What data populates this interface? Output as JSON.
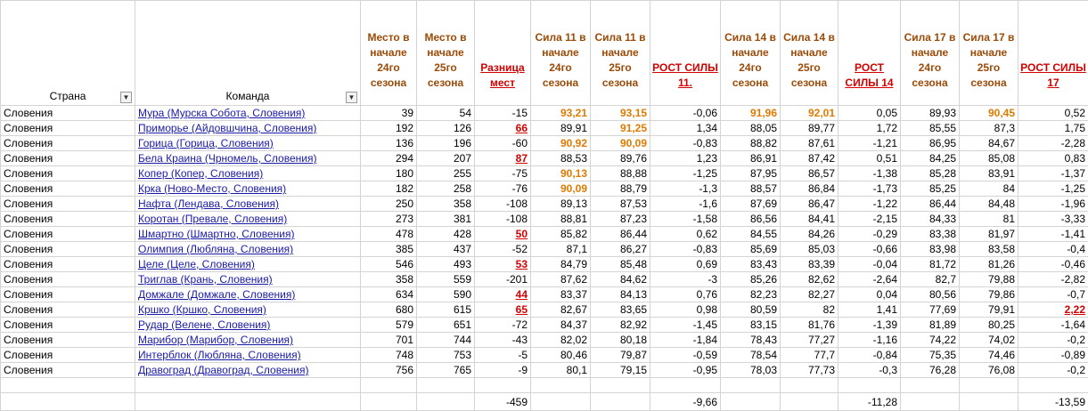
{
  "headers": {
    "country": "Страна",
    "team": "Команда",
    "place24": "Место в начале 24го сезона",
    "place25": "Место в начале 25го сезона",
    "diff": "Разница мест",
    "s11_24": "Сила 11 в начале 24го сезона",
    "s11_25": "Сила 11 в начале 25го сезона",
    "g11": "РОСТ СИЛЫ 11.",
    "s14_24": "Сила 14 в начале 24го сезона",
    "s14_25": "Сила 14 в начале 25го сезона",
    "g14": "РОСТ СИЛЫ 14",
    "s17_24": "Сила 17 в начале 24го сезона",
    "s17_25": "Сила 17 в начале 25го сезона",
    "g17": "РОСТ СИЛЫ 17"
  },
  "icons": {
    "country_filter": "filter-active-icon",
    "team_filter": "dropdown-arrow-icon"
  },
  "colors": {
    "highlight": "#e07a00",
    "red": "#d40000",
    "header": "#9c4a07",
    "link": "#1a1aa8"
  },
  "rows": [
    {
      "country": "Словения",
      "team": "Мура (Мурска Собота, Словения)",
      "p24": "39",
      "p25": "54",
      "diff": "-15",
      "s11a": "93,21",
      "s11b": "93,15",
      "g11": "-0,06",
      "s14a": "91,96",
      "s14b": "92,01",
      "g14": "0,05",
      "s17a": "89,93",
      "s17b": "90,45",
      "g17": "0,52",
      "hl": [
        "s11a",
        "s11b",
        "s14a",
        "s14b",
        "s17b"
      ]
    },
    {
      "country": "Словения",
      "team": "Приморье (Айдовшчина, Словения)",
      "p24": "192",
      "p25": "126",
      "diff": "66",
      "s11a": "89,91",
      "s11b": "91,25",
      "g11": "1,34",
      "s14a": "88,05",
      "s14b": "89,77",
      "g14": "1,72",
      "s17a": "85,55",
      "s17b": "87,3",
      "g17": "1,75",
      "hl": [
        "s11b"
      ],
      "rd": [
        "diff"
      ]
    },
    {
      "country": "Словения",
      "team": "Горица (Горица, Словения)",
      "p24": "136",
      "p25": "196",
      "diff": "-60",
      "s11a": "90,92",
      "s11b": "90,09",
      "g11": "-0,83",
      "s14a": "88,82",
      "s14b": "87,61",
      "g14": "-1,21",
      "s17a": "86,95",
      "s17b": "84,67",
      "g17": "-2,28",
      "hl": [
        "s11a",
        "s11b"
      ]
    },
    {
      "country": "Словения",
      "team": "Бела Краина (Чрномель, Словения)",
      "p24": "294",
      "p25": "207",
      "diff": "87",
      "s11a": "88,53",
      "s11b": "89,76",
      "g11": "1,23",
      "s14a": "86,91",
      "s14b": "87,42",
      "g14": "0,51",
      "s17a": "84,25",
      "s17b": "85,08",
      "g17": "0,83",
      "rd": [
        "diff"
      ]
    },
    {
      "country": "Словения",
      "team": "Копер (Копер, Словения)",
      "p24": "180",
      "p25": "255",
      "diff": "-75",
      "s11a": "90,13",
      "s11b": "88,88",
      "g11": "-1,25",
      "s14a": "87,95",
      "s14b": "86,57",
      "g14": "-1,38",
      "s17a": "85,28",
      "s17b": "83,91",
      "g17": "-1,37",
      "hl": [
        "s11a"
      ]
    },
    {
      "country": "Словения",
      "team": "Крка (Ново-Место, Словения)",
      "p24": "182",
      "p25": "258",
      "diff": "-76",
      "s11a": "90,09",
      "s11b": "88,79",
      "g11": "-1,3",
      "s14a": "88,57",
      "s14b": "86,84",
      "g14": "-1,73",
      "s17a": "85,25",
      "s17b": "84",
      "g17": "-1,25",
      "hl": [
        "s11a"
      ]
    },
    {
      "country": "Словения",
      "team": "Нафта (Лендава, Словения)",
      "p24": "250",
      "p25": "358",
      "diff": "-108",
      "s11a": "89,13",
      "s11b": "87,53",
      "g11": "-1,6",
      "s14a": "87,69",
      "s14b": "86,47",
      "g14": "-1,22",
      "s17a": "86,44",
      "s17b": "84,48",
      "g17": "-1,96"
    },
    {
      "country": "Словения",
      "team": "Коротан (Превале, Словения)",
      "p24": "273",
      "p25": "381",
      "diff": "-108",
      "s11a": "88,81",
      "s11b": "87,23",
      "g11": "-1,58",
      "s14a": "86,56",
      "s14b": "84,41",
      "g14": "-2,15",
      "s17a": "84,33",
      "s17b": "81",
      "g17": "-3,33"
    },
    {
      "country": "Словения",
      "team": "Шмартно (Шмартно, Словения)",
      "p24": "478",
      "p25": "428",
      "diff": "50",
      "s11a": "85,82",
      "s11b": "86,44",
      "g11": "0,62",
      "s14a": "84,55",
      "s14b": "84,26",
      "g14": "-0,29",
      "s17a": "83,38",
      "s17b": "81,97",
      "g17": "-1,41",
      "rd": [
        "diff"
      ]
    },
    {
      "country": "Словения",
      "team": "Олимпия (Любляна, Словения)",
      "p24": "385",
      "p25": "437",
      "diff": "-52",
      "s11a": "87,1",
      "s11b": "86,27",
      "g11": "-0,83",
      "s14a": "85,69",
      "s14b": "85,03",
      "g14": "-0,66",
      "s17a": "83,98",
      "s17b": "83,58",
      "g17": "-0,4"
    },
    {
      "country": "Словения",
      "team": "Целе (Целе, Словения)",
      "p24": "546",
      "p25": "493",
      "diff": "53",
      "s11a": "84,79",
      "s11b": "85,48",
      "g11": "0,69",
      "s14a": "83,43",
      "s14b": "83,39",
      "g14": "-0,04",
      "s17a": "81,72",
      "s17b": "81,26",
      "g17": "-0,46",
      "rd": [
        "diff"
      ]
    },
    {
      "country": "Словения",
      "team": "Триглав (Крань, Словения)",
      "p24": "358",
      "p25": "559",
      "diff": "-201",
      "s11a": "87,62",
      "s11b": "84,62",
      "g11": "-3",
      "s14a": "85,26",
      "s14b": "82,62",
      "g14": "-2,64",
      "s17a": "82,7",
      "s17b": "79,88",
      "g17": "-2,82"
    },
    {
      "country": "Словения",
      "team": "Домжале (Домжале, Словения)",
      "p24": "634",
      "p25": "590",
      "diff": "44",
      "s11a": "83,37",
      "s11b": "84,13",
      "g11": "0,76",
      "s14a": "82,23",
      "s14b": "82,27",
      "g14": "0,04",
      "s17a": "80,56",
      "s17b": "79,86",
      "g17": "-0,7",
      "rd": [
        "diff"
      ]
    },
    {
      "country": "Словения",
      "team": "Кршко (Кршко, Словения)",
      "p24": "680",
      "p25": "615",
      "diff": "65",
      "s11a": "82,67",
      "s11b": "83,65",
      "g11": "0,98",
      "s14a": "80,59",
      "s14b": "82",
      "g14": "1,41",
      "s17a": "77,69",
      "s17b": "79,91",
      "g17": "2,22",
      "rd": [
        "diff",
        "g17"
      ]
    },
    {
      "country": "Словения",
      "team": "Рудар (Велене, Словения)",
      "p24": "579",
      "p25": "651",
      "diff": "-72",
      "s11a": "84,37",
      "s11b": "82,92",
      "g11": "-1,45",
      "s14a": "83,15",
      "s14b": "81,76",
      "g14": "-1,39",
      "s17a": "81,89",
      "s17b": "80,25",
      "g17": "-1,64"
    },
    {
      "country": "Словения",
      "team": "Марибор (Марибор, Словения)",
      "p24": "701",
      "p25": "744",
      "diff": "-43",
      "s11a": "82,02",
      "s11b": "80,18",
      "g11": "-1,84",
      "s14a": "78,43",
      "s14b": "77,27",
      "g14": "-1,16",
      "s17a": "74,22",
      "s17b": "74,02",
      "g17": "-0,2"
    },
    {
      "country": "Словения",
      "team": "Интерблок (Любляна, Словения)",
      "p24": "748",
      "p25": "753",
      "diff": "-5",
      "s11a": "80,46",
      "s11b": "79,87",
      "g11": "-0,59",
      "s14a": "78,54",
      "s14b": "77,7",
      "g14": "-0,84",
      "s17a": "75,35",
      "s17b": "74,46",
      "g17": "-0,89"
    },
    {
      "country": "Словения",
      "team": "Дравоград (Дравоград, Словения)",
      "p24": "756",
      "p25": "765",
      "diff": "-9",
      "s11a": "80,1",
      "s11b": "79,15",
      "g11": "-0,95",
      "s14a": "78,03",
      "s14b": "77,73",
      "g14": "-0,3",
      "s17a": "76,28",
      "s17b": "76,08",
      "g17": "-0,2"
    }
  ],
  "totals": {
    "diff": "-459",
    "g11": "-9,66",
    "g14": "-11,28",
    "g17": "-13,59"
  }
}
